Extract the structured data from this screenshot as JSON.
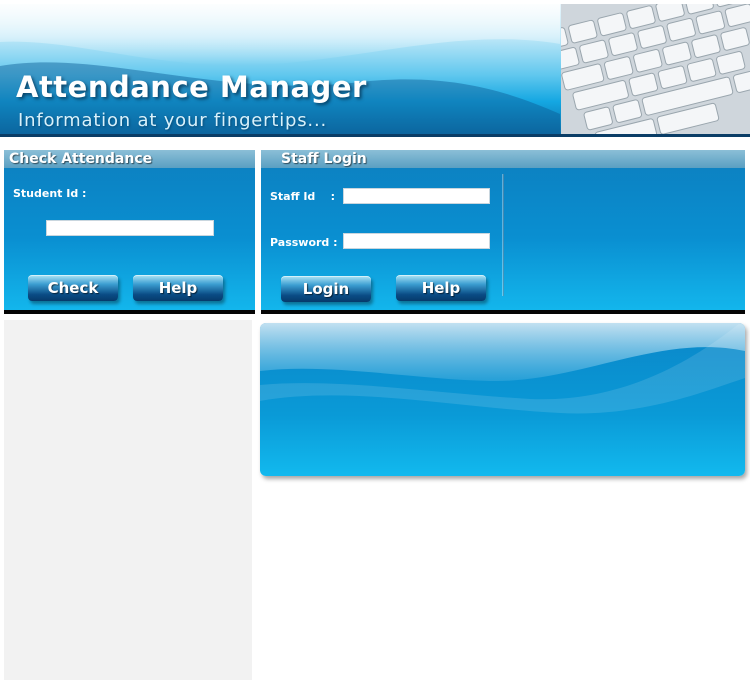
{
  "header": {
    "title": "Attendance Manager",
    "tagline": "Information at your fingertips..."
  },
  "check_attendance": {
    "title": "Check Attendance",
    "student_id_label": "Student Id :",
    "student_id_value": "",
    "check_button": "Check",
    "help_button": "Help"
  },
  "staff_login": {
    "title": "Staff Login",
    "staff_id_label": "Staff Id    :",
    "staff_id_value": "",
    "password_label": "Password :",
    "password_value": "",
    "login_button": "Login",
    "help_button": "Help"
  },
  "colors": {
    "panel_blue": "#0a8fd1",
    "header_bar": "#5a9fc2",
    "button_dark": "#063a6b",
    "left_column_bg": "#f2f2f2"
  }
}
